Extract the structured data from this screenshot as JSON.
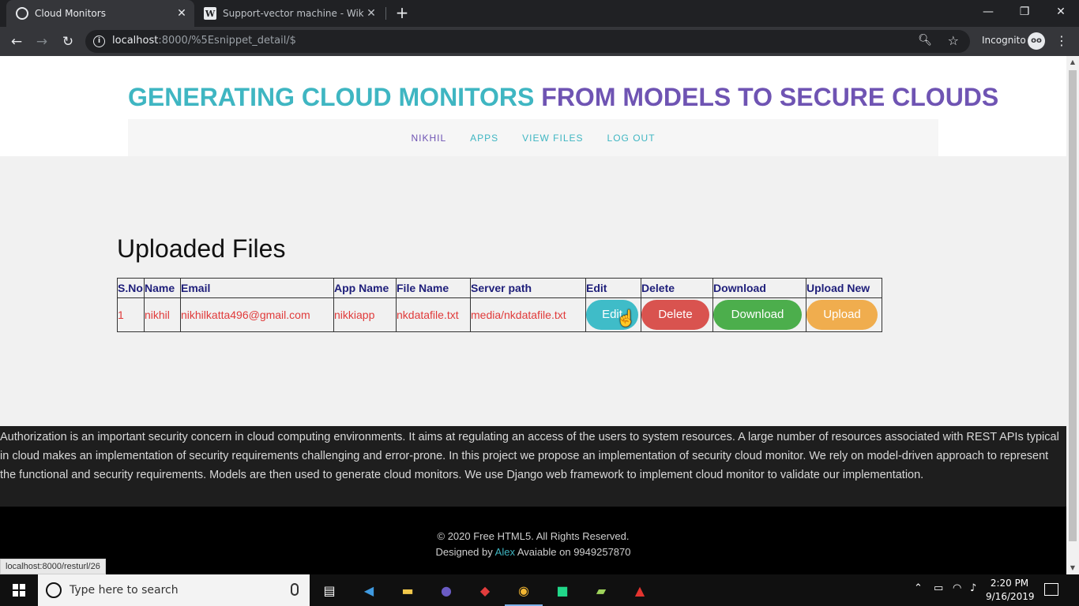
{
  "browser": {
    "tabs": [
      {
        "title": "Cloud Monitors",
        "favicon": "globe-icon"
      },
      {
        "title": "Support-vector machine - Wikipe",
        "favicon": "wikipedia-icon"
      }
    ],
    "url_host": "localhost",
    "url_rest": ":8000/%5Esnippet_detail/$",
    "incognito_label": "Incognito",
    "status_url": "localhost:8000/resturl/26"
  },
  "site": {
    "title_part1": "GENERATING CLOUD MONITORS",
    "title_part2": "FROM MODELS TO SECURE CLOUDS",
    "nav": [
      "NIKHIL",
      "APPS",
      "VIEW FILES",
      "LOG OUT"
    ]
  },
  "main": {
    "heading": "Uploaded Files",
    "table": {
      "headers": [
        "S.No",
        "Name",
        "Email",
        "App Name",
        "File Name",
        "Server path",
        "Edit",
        "Delete",
        "Download",
        "Upload New"
      ],
      "rows": [
        {
          "sno": "1",
          "name": "nikhil",
          "email": "nikhilkatta496@gmail.com",
          "app_name": "nikkiapp",
          "file_name": "nkdatafile.txt",
          "server_path": "media/nkdatafile.txt",
          "edit_label": "Edit",
          "delete_label": "Delete",
          "download_label": "Download",
          "upload_label": "Upload"
        }
      ]
    }
  },
  "about": {
    "text": "Authorization is an important security concern in cloud computing environments. It aims at regulating an access of the users to system resources. A large number of resources associated with REST APIs typical in cloud makes an implementation of security requirements challenging and error-prone. In this project we propose an implementation of security cloud monitor. We rely on model-driven approach to represent the functional and security requirements. Models are then used to generate cloud monitors. We use Django web framework to implement cloud monitor to validate our implementation."
  },
  "footer": {
    "copyright": "© 2020 Free HTML5. All Rights Reserved.",
    "designed_by": "Designed by",
    "author": "Alex",
    "available": "Avaiable on 9949257870"
  },
  "taskbar": {
    "search_placeholder": "Type here to search",
    "time": "2:20 PM",
    "date": "9/16/2019"
  },
  "colors": {
    "accent_teal": "#3fb6c2",
    "accent_purple": "#6f54b3",
    "edit": "#3fbcc8",
    "delete": "#d9534f",
    "download": "#4cae4c",
    "upload": "#f0ad4e"
  }
}
